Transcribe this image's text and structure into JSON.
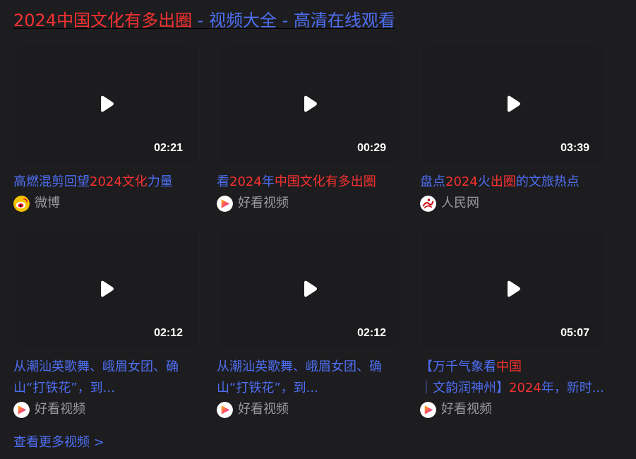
{
  "header": {
    "title_highlight": "2024中国文化有多出圈",
    "title_rest": " - 视频大全 - 高清在线观看"
  },
  "colors": {
    "background": "#1d1d1f",
    "link": "#4e6ef2",
    "highlight": "#f73131",
    "source_text": "#9a9a9e"
  },
  "videos": [
    {
      "duration": "02:21",
      "title_parts": [
        {
          "t": "高燃混剪回望",
          "h": false
        },
        {
          "t": "2024文化",
          "h": true
        },
        {
          "t": "力量",
          "h": false
        }
      ],
      "source": "微博",
      "source_icon": "weibo-icon"
    },
    {
      "duration": "00:29",
      "title_parts": [
        {
          "t": "看",
          "h": false
        },
        {
          "t": "2024",
          "h": true
        },
        {
          "t": "年",
          "h": false
        },
        {
          "t": "中国文化有多出圈",
          "h": true
        }
      ],
      "source": "好看视频",
      "source_icon": "haokan-icon"
    },
    {
      "duration": "03:39",
      "title_parts": [
        {
          "t": "盘点",
          "h": false
        },
        {
          "t": "2024",
          "h": true
        },
        {
          "t": "火",
          "h": false
        },
        {
          "t": "出圈",
          "h": true
        },
        {
          "t": "的文旅热点",
          "h": false
        }
      ],
      "source": "人民网",
      "source_icon": "peoples-daily-icon"
    },
    {
      "duration": "02:12",
      "title_parts": [
        {
          "t": "从潮汕英歌舞、峨眉女团、确山“打铁花”，到...",
          "h": false
        }
      ],
      "source": "好看视频",
      "source_icon": "haokan-icon"
    },
    {
      "duration": "02:12",
      "title_parts": [
        {
          "t": "从潮汕英歌舞、峨眉女团、确山“打铁花”，到...",
          "h": false
        }
      ],
      "source": "好看视频",
      "source_icon": "haokan-icon"
    },
    {
      "duration": "05:07",
      "title_parts": [
        {
          "t": "【万千气象看",
          "h": false
        },
        {
          "t": "中国",
          "h": true
        },
        {
          "t": "｜文韵润神州】",
          "h": false
        },
        {
          "t": "2024",
          "h": true
        },
        {
          "t": "年，新时...",
          "h": false
        }
      ],
      "source": "好看视频",
      "source_icon": "haokan-icon"
    }
  ],
  "footer": {
    "more_label": "查看更多视频 >"
  }
}
